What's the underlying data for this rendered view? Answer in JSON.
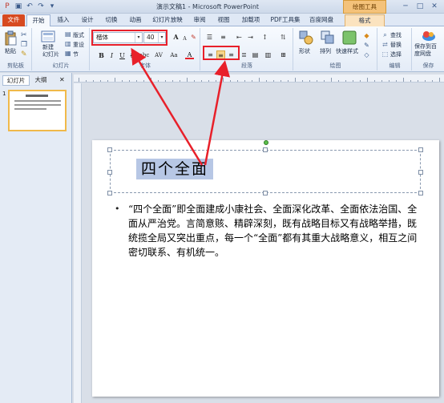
{
  "window": {
    "title": "演示文稿1 - Microsoft PowerPoint",
    "context_group": "绘图工具",
    "window_controls": [
      "─",
      "□",
      "✕"
    ]
  },
  "quick_access": [
    "save-icon",
    "undo-icon",
    "redo-icon",
    "customize-icon"
  ],
  "tabs": [
    {
      "label": "文件"
    },
    {
      "label": "开始"
    },
    {
      "label": "插入"
    },
    {
      "label": "设计"
    },
    {
      "label": "切换"
    },
    {
      "label": "动画"
    },
    {
      "label": "幻灯片放映"
    },
    {
      "label": "审阅"
    },
    {
      "label": "视图"
    },
    {
      "label": "加载项"
    },
    {
      "label": "PDF工具集"
    },
    {
      "label": "百度网盘"
    },
    {
      "label": "格式"
    }
  ],
  "ribbon": {
    "clipboard": {
      "paste": "粘贴",
      "group": "剪贴板"
    },
    "slides": {
      "new_slide": "新建\n幻灯片",
      "layout": "版式",
      "reset": "重设",
      "section": "节",
      "group": "幻灯片"
    },
    "font": {
      "name": "楷体",
      "size": "40",
      "bold": "B",
      "italic": "I",
      "underline": "U",
      "strike": "S",
      "shadow": "abc",
      "spacing": "AV",
      "case": "Aa",
      "color": "A",
      "grow": "A",
      "shrink": "A",
      "group": "字体"
    },
    "paragraph": {
      "group": "段落"
    },
    "drawing": {
      "shapes": "形状",
      "arrange": "排列",
      "quick_styles": "快速样式",
      "group": "绘图"
    },
    "editing": {
      "find": "查找",
      "replace": "替换",
      "select": "选择",
      "group": "编辑"
    },
    "save": {
      "label": "保存到百\n度网盘",
      "group": "保存"
    }
  },
  "left_panel": {
    "tab_slides": "幻灯片",
    "tab_outline": "大纲",
    "slide_number": "1"
  },
  "slide": {
    "title": "四个全面",
    "body": "“四个全面”即全面建成小康社会、全面深化改革、全面依法治国、全面从严治党。言简意赅、精辟深刻，既有战略目标又有战略举措，既统揽全局又突出重点，每一个“全面”都有其重大战略意义，相互之间密切联系、有机统一。"
  },
  "colors": {
    "accent_red": "#e8202a",
    "file_tab": "#d74a20",
    "title_highlight": "#b7c7e5"
  }
}
